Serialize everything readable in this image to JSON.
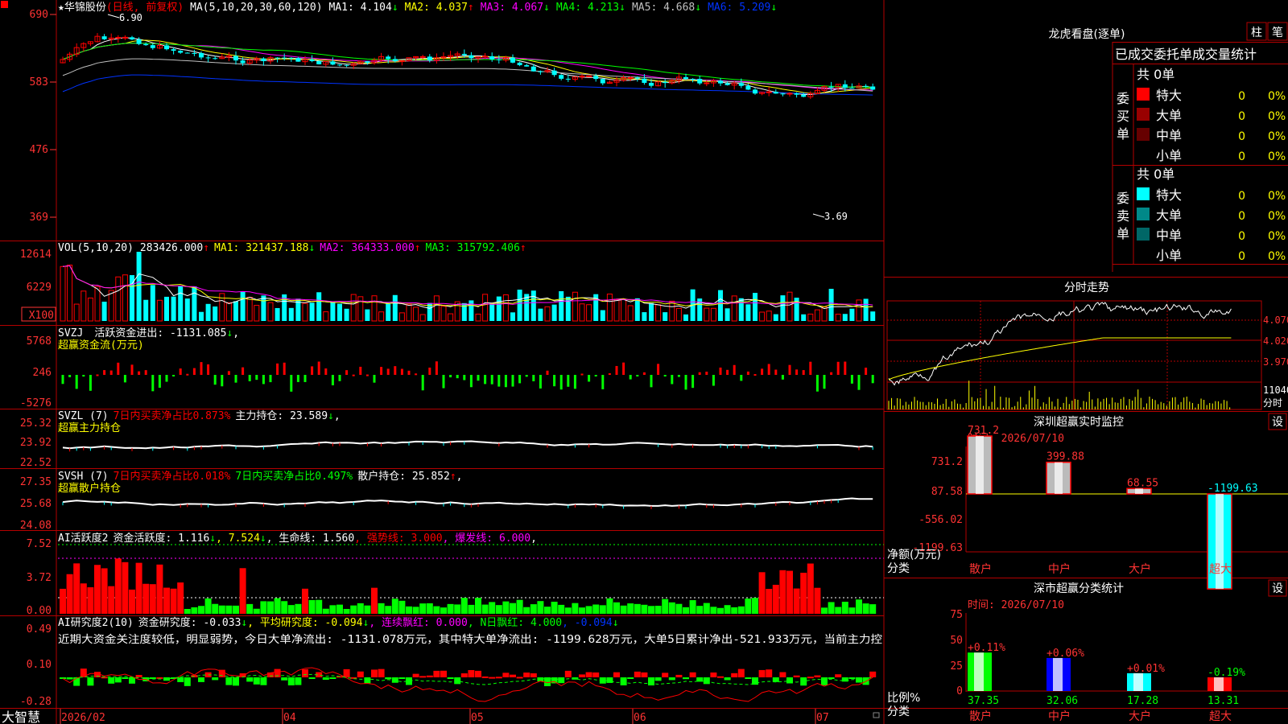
{
  "stock": {
    "name": "华锦股份",
    "star": "★",
    "mode": "(日线, 前复权)"
  },
  "ma_header": {
    "label": "MA(5,10,20,30,60,120)",
    "ma1": "MA1: 4.104",
    "ma1_arrow": "↓",
    "ma2": "MA2: 4.037",
    "ma2_arrow": "↑",
    "ma3": "MA3: 4.067",
    "ma3_arrow": "↓",
    "ma4": "MA4: 4.213",
    "ma4_arrow": "↓",
    "ma5": "MA5: 4.668",
    "ma5_arrow": "↓",
    "ma6": "MA6: 5.209",
    "ma6_arrow": "↓"
  },
  "price_axis": [
    "690",
    "583",
    "476",
    "369"
  ],
  "price_annotations": {
    "high": "6.90",
    "low": "3.69"
  },
  "vol_header": {
    "label": "VOL(5,10,20)",
    "value": "283426.000",
    "v_arrow": "↑",
    "ma1": "MA1: 321437.188",
    "ma1_arrow": "↓",
    "ma2": "MA2: 364333.000",
    "ma2_arrow": "↑",
    "ma3": "MA3: 315792.406",
    "ma3_arrow": "↑"
  },
  "vol_axis": [
    "12614",
    "6229",
    "X100"
  ],
  "svzj": {
    "label": "SVZJ",
    "text": "活跃资金进出: -1131.085",
    "arrow": "↓",
    "comma": ",",
    "sub": "超赢资金流(万元)",
    "axis": [
      "5768",
      "246",
      "-5276"
    ]
  },
  "svzl": {
    "label": "SVZL (7)",
    "pct": "7日内买卖净占比0.873%",
    "text": "主力持仓: 23.589",
    "arrow": "↓",
    "comma": ",",
    "sub": "超赢主力持仓",
    "axis": [
      "25.32",
      "23.92",
      "22.52"
    ]
  },
  "svsh": {
    "label": "SVSH (7)",
    "pct1": "7日内买卖净占比0.018%",
    "pct2": "7日内买卖净占比0.497%",
    "text": "散户持仓: 25.852",
    "arrow": "↑",
    "comma": ",",
    "sub": "超赢散户持仓",
    "axis": [
      "27.35",
      "25.68",
      "24.08"
    ]
  },
  "ai_active": {
    "label": "AI活跃度2",
    "text": "资金活跃度: 1.116",
    "arrow1": "↓",
    "v2": ", 7.524",
    "arrow2": "↓",
    "life": ", 生命线: 1.560",
    "strong": ", 强势线: 3.000",
    "burst": ", 爆发线: 6.000",
    "end": ",",
    "axis": [
      "7.52",
      "3.72",
      "0.00"
    ]
  },
  "ai_research": {
    "label": "AI研究度2(10)",
    "text": "资金研究度: -0.033",
    "arrow1": "↓",
    "avg": ", 平均研究度: -0.094",
    "arrow2": "↓",
    "cont": ", 连续飘红: 0.000",
    "nday": ", N日飘红: 4.000",
    "v": ", -0.094",
    "arrow3": "↓",
    "comment": "近期大资金关注度较低，明显弱势，今日大单净流出: -1131.078万元，其中特大单净流出: -1199.628万元，大单5日累计净出-521.933万元，当前主力控",
    "axis": [
      "0.49",
      "0.10",
      "-0.28"
    ]
  },
  "date_axis": {
    "logo": "大智慧",
    "labels": [
      "2026/02",
      "04",
      "05",
      "06",
      "07"
    ]
  },
  "right": {
    "lh_title": "龙虎看盘(逐单)",
    "btn_bar": "柱",
    "btn_pen": "笔",
    "stat_title": "已成交委托单成交量统计",
    "buy": {
      "side_label": "委买单",
      "count": "共 0单",
      "rows": [
        {
          "label": "特大",
          "val": "0",
          "pct": "0%",
          "color": "#ff0000"
        },
        {
          "label": "大单",
          "val": "0",
          "pct": "0%",
          "color": "#990000"
        },
        {
          "label": "中单",
          "val": "0",
          "pct": "0%",
          "color": "#660000"
        },
        {
          "label": "小单",
          "val": "0",
          "pct": "0%",
          "color": "#000000"
        }
      ]
    },
    "sell": {
      "side_label": "委卖单",
      "count": "共 0单",
      "rows": [
        {
          "label": "特大",
          "val": "0",
          "pct": "0%",
          "color": "#00ffff"
        },
        {
          "label": "大单",
          "val": "0",
          "pct": "0%",
          "color": "#008888"
        },
        {
          "label": "中单",
          "val": "0",
          "pct": "0%",
          "color": "#006666"
        },
        {
          "label": "小单",
          "val": "0",
          "pct": "0%",
          "color": "#000000"
        }
      ]
    },
    "intraday": {
      "title": "分时走势",
      "axis": [
        "4.070",
        "4.020",
        "3.970"
      ],
      "vol": "11040",
      "vol_unit": "分时"
    },
    "monitor": {
      "title": "深圳超赢实时监控",
      "btn": "设",
      "time": "时间: 2026/07/10",
      "axis": [
        "731.2",
        "87.58",
        "-556.02",
        "-1199.63"
      ],
      "ylabel": "净额(万元)",
      "xlabel": "分类",
      "values": [
        "731.2",
        "399.88",
        "68.55",
        "-1199.63"
      ],
      "cats": [
        "散户",
        "中户",
        "大户",
        "超大"
      ]
    },
    "classify": {
      "title": "深市超赢分类统计",
      "btn": "设",
      "time": "时间: 2026/07/10",
      "axis": [
        "75",
        "50",
        "25",
        "0"
      ],
      "ylabel": "比例%",
      "xlabel": "分类",
      "pcts": [
        "+0.11%",
        "+0.06%",
        "+0.01%",
        "-0.19%"
      ],
      "values": [
        "37.35",
        "32.06",
        "17.28",
        "13.31"
      ],
      "cats": [
        "散户",
        "中户",
        "大户",
        "超大"
      ]
    }
  },
  "colors": {
    "up": "#ff0000",
    "down": "#00ffff",
    "grid": "#b40000",
    "axis_text": "#ff3333",
    "yellow": "#ffff00",
    "magenta": "#ff00ff",
    "green": "#00ff00",
    "blue": "#0033ff",
    "grey": "#c0c0c0"
  }
}
